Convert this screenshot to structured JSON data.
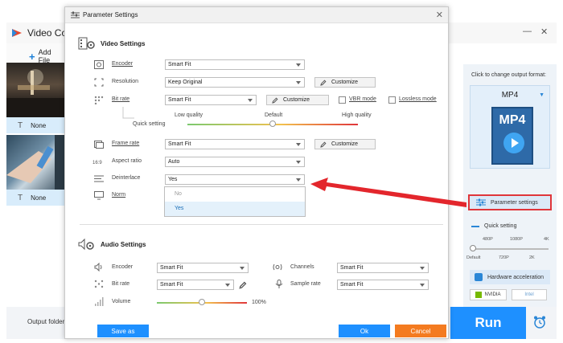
{
  "app": {
    "title": "Video Conv",
    "add_files_label": "Add File",
    "files": [
      {
        "subtitle": "None"
      },
      {
        "subtitle": "None"
      }
    ],
    "output_format_caption": "Click to change output format:",
    "output_format": "MP4",
    "output_format_icon_text": "MP4",
    "parameter_settings_label": "Parameter settings",
    "quick_setting_label": "Quick setting",
    "quick_top_ticks": [
      "480P",
      "1080P",
      "4K"
    ],
    "quick_bottom_ticks": [
      "Default",
      "720P",
      "2K"
    ],
    "hardware_acceleration_label": "Hardware acceleration",
    "vendors": [
      "NVIDIA",
      "Intel"
    ],
    "output_folder_label": "Output folder:",
    "run_label": "Run"
  },
  "dialog": {
    "title": "Parameter Settings",
    "video_settings_title": "Video Settings",
    "audio_settings_title": "Audio Settings",
    "video": {
      "encoder": {
        "label": "Encoder",
        "value": "Smart Fit"
      },
      "resolution": {
        "label": "Resolution",
        "value": "Keep Original",
        "customize": "Customize"
      },
      "bitrate": {
        "label": "Bit rate",
        "value": "Smart Fit",
        "customize": "Customize",
        "vbr_label": "VBR mode",
        "lossless_label": "Lossless mode"
      },
      "quick_setting": {
        "label": "Quick setting",
        "low": "Low quality",
        "default": "Default",
        "high": "High quality",
        "level": 0.5
      },
      "frame_rate": {
        "label": "Frame rate",
        "value": "Smart Fit",
        "customize": "Customize"
      },
      "aspect_ratio": {
        "label": "Aspect ratio",
        "value": "Auto"
      },
      "deinterlace": {
        "label": "Deinterlace",
        "value": "Yes",
        "options": [
          "No",
          "Yes"
        ],
        "selected": "Yes"
      },
      "norm": {
        "label": "Norm"
      }
    },
    "audio": {
      "encoder": {
        "label": "Encoder",
        "value": "Smart Fit"
      },
      "channels": {
        "label": "Channels",
        "value": "Smart Fit"
      },
      "bitrate": {
        "label": "Bit rate",
        "value": "Smart Fit"
      },
      "sample_rate": {
        "label": "Sample rate",
        "value": "Smart Fit"
      },
      "volume": {
        "label": "Volume",
        "value": "100%",
        "level": 0.5
      }
    },
    "buttons": {
      "save_as": "Save as",
      "ok": "Ok",
      "cancel": "Cancel"
    }
  },
  "colors": {
    "accent": "#1e90ff",
    "cancel": "#f47b20",
    "highlight_border": "#e0353a",
    "arrow": "#e3262c"
  }
}
